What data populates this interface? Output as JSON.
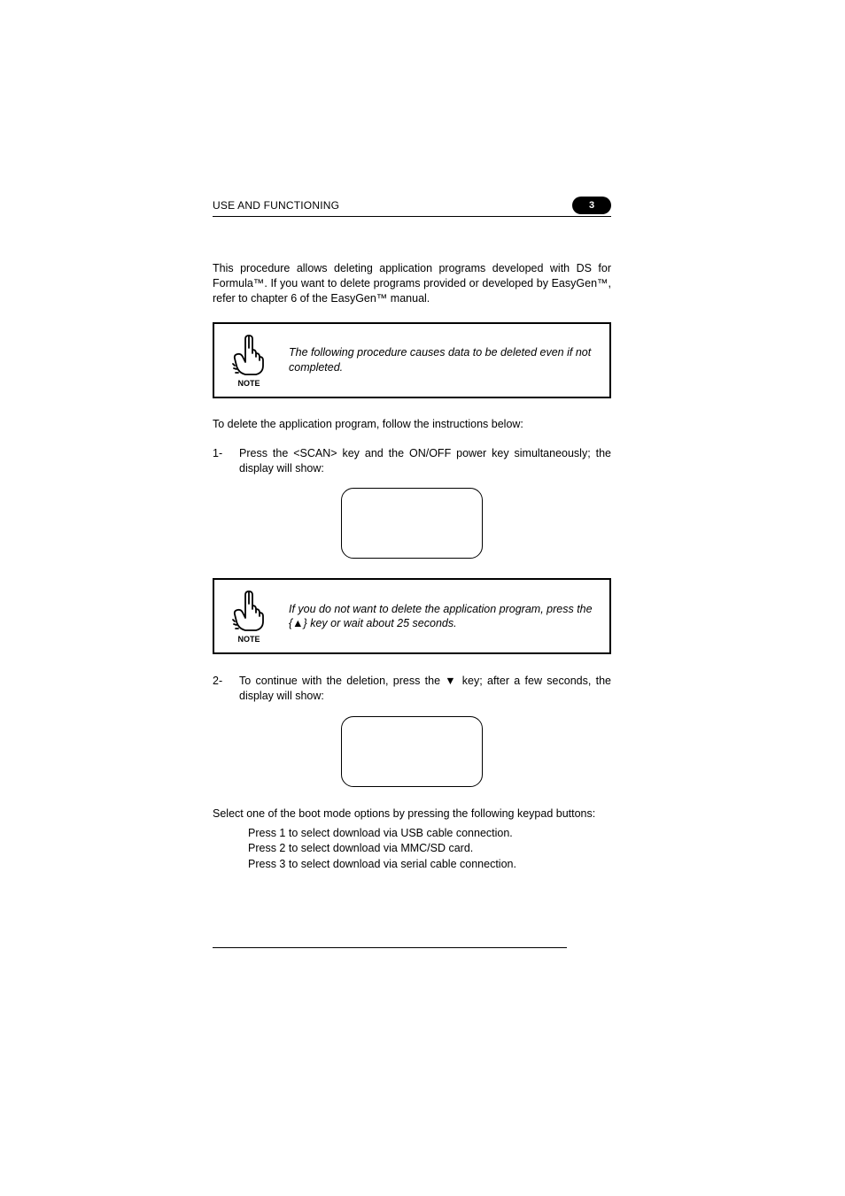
{
  "header": {
    "title": "USE AND FUNCTIONING",
    "badge": "3"
  },
  "intro": "This procedure allows deleting application programs developed with DS for Formula™. If you want to delete programs provided or developed by EasyGen™, refer to chapter 6 of the EasyGen™ manual.",
  "note1": {
    "label": "NOTE",
    "text": "The following procedure causes data to be deleted even if not completed."
  },
  "lead": "To delete the application program, follow the instructions below:",
  "step1": {
    "num": "1-",
    "text": "Press the <SCAN> key and the ON/OFF power key simultaneously; the display will show:"
  },
  "note2": {
    "label": "NOTE",
    "text": "If you do not want to delete the application program, press the {▲} key or wait about 25 seconds."
  },
  "step2": {
    "num": "2-",
    "text": "To continue with the deletion, press the ▼ key; after a few seconds, the display will show:"
  },
  "boot": {
    "lead": "Select one of the boot mode options by pressing the following keypad buttons:",
    "opt1": "Press 1 to select download via USB cable connection.",
    "opt2": "Press 2 to select download via MMC/SD card.",
    "opt3": "Press 3 to select download via serial cable connection."
  }
}
